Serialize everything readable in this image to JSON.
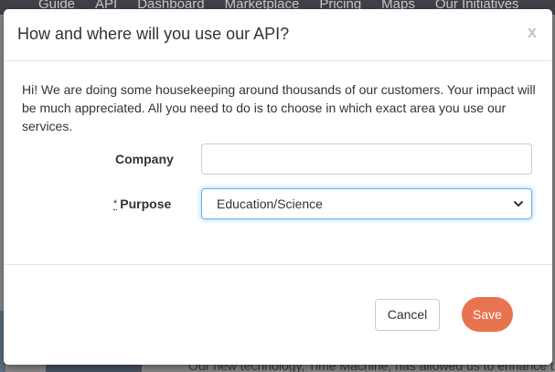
{
  "background": {
    "nav_items": [
      "Guide",
      "API",
      "Dashboard",
      "Marketplace",
      "Pricing",
      "Maps",
      "Our Initiatives"
    ],
    "footer_text": "Our new technology, Time Machine, has allowed us to enhance t"
  },
  "modal": {
    "title": "How and where will you use our API?",
    "close_label": "x",
    "intro": "Hi! We are doing some housekeeping around thousands of our customers. Your impact will be much appreciated. All you need to do is to choose in which exact area you use our services.",
    "company": {
      "label": "Company",
      "value": ""
    },
    "purpose": {
      "required_marker": "*",
      "label": "Purpose",
      "selected": "Education/Science"
    },
    "footer": {
      "cancel_label": "Cancel",
      "save_label": "Save"
    }
  },
  "colors": {
    "save_button": "#e8734f",
    "focus_border": "#66afe9"
  }
}
